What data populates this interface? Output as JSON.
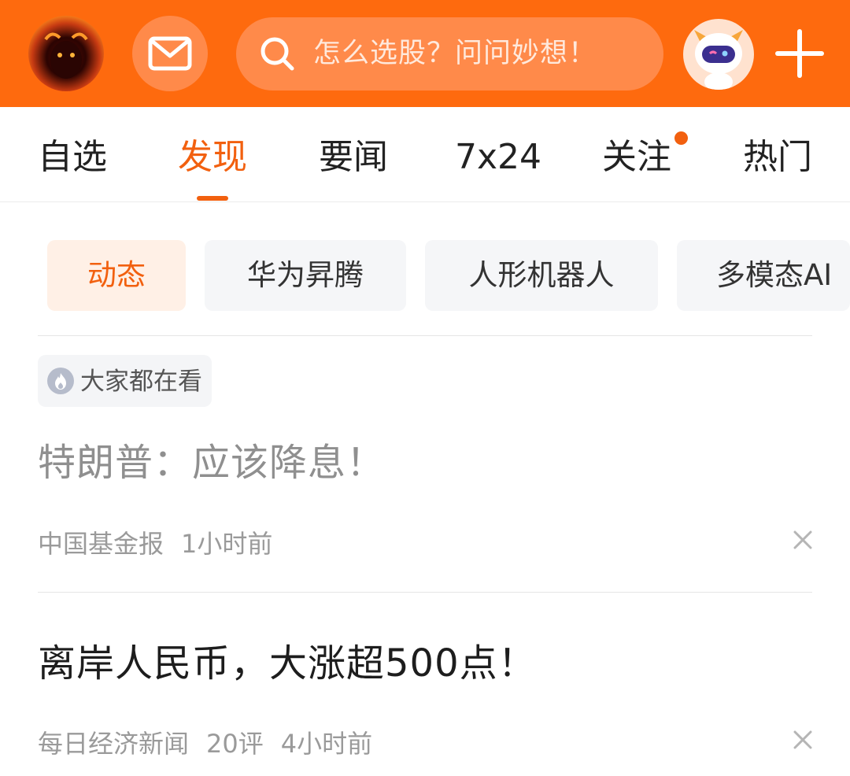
{
  "header": {
    "search_placeholder": "怎么选股？问问妙想！"
  },
  "tabs": [
    {
      "label": "自选",
      "active": false
    },
    {
      "label": "发现",
      "active": true
    },
    {
      "label": "要闻",
      "active": false
    },
    {
      "label": "7x24",
      "active": false
    },
    {
      "label": "关注",
      "active": false,
      "has_dot": true
    },
    {
      "label": "热门",
      "active": false
    }
  ],
  "chips": [
    {
      "label": "动态",
      "active": true
    },
    {
      "label": "华为昇腾",
      "active": false
    },
    {
      "label": "人形机器人",
      "active": false
    },
    {
      "label": "多模态AI",
      "active": false
    }
  ],
  "feed": {
    "badge": "大家都在看",
    "items": [
      {
        "title": "特朗普：应该降息！",
        "read": true,
        "source": "中国基金报",
        "comments": "",
        "time": "1小时前"
      },
      {
        "title": "离岸人民币，大涨超500点！",
        "read": false,
        "source": "每日经济新闻",
        "comments": "20评",
        "time": "4小时前"
      }
    ]
  },
  "colors": {
    "brand_orange": "#fe6a0e",
    "active_tab": "#f2600f"
  },
  "icons": [
    "profile-avatar",
    "mail-icon",
    "search-icon",
    "robot-assistant-icon",
    "plus-icon",
    "fire-icon",
    "close-icon"
  ]
}
